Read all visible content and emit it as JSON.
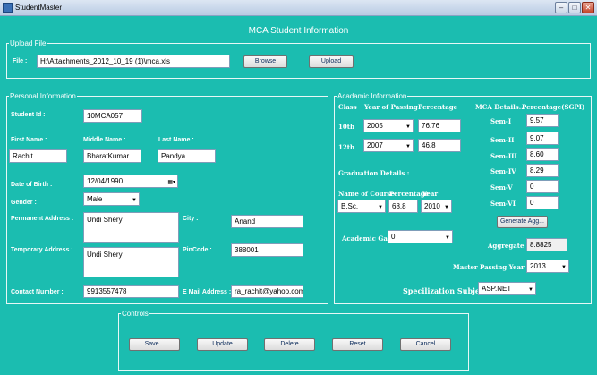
{
  "window": {
    "title": "StudentMaster",
    "min": "–",
    "max": "□",
    "close": "✕"
  },
  "form_title": "MCA Student Information",
  "upload": {
    "legend": "Upload File",
    "file_label": "File :",
    "file_value": "H:\\Attachments_2012_10_19 (1)\\mca.xls",
    "browse": "Browse",
    "upload": "Upload"
  },
  "personal": {
    "legend": "Personal Information",
    "student_id_label": "Student Id :",
    "student_id": "10MCA057",
    "first_name_label": "First Name :",
    "first_name": "Rachit",
    "middle_name_label": "Middle Name :",
    "middle_name": "BharatKumar",
    "last_name_label": "Last Name :",
    "last_name": "Pandya",
    "dob_label": "Date of Birth :",
    "dob": "12/04/1990",
    "gender_label": "Gender :",
    "gender": "Male",
    "perm_addr_label": "Permanent Address :",
    "perm_addr": "Undi Shery",
    "temp_addr_label": "Temporary Address :",
    "temp_addr": "Undi Shery",
    "city_label": "City :",
    "city": "Anand",
    "pincode_label": "PinCode :",
    "pincode": "388001",
    "contact_label": "Contact Number :",
    "contact": "9913557478",
    "email_label": "E Mail Address :",
    "email": "ra_rachit@yahoo.com"
  },
  "academic": {
    "legend": "Acadamic Information",
    "class_header": "Class",
    "year_header": "Year of Passing",
    "pct_header": "Percentage",
    "rows": [
      {
        "class": "10th",
        "year": "2005",
        "pct": "76.76"
      },
      {
        "class": "12th",
        "year": "2007",
        "pct": "46.8"
      }
    ],
    "grad_label": "Graduation Details :",
    "course_header": "Name of Course",
    "grad_pct_header": "Percentage",
    "grad_year_header": "Year",
    "course": "B.Sc.",
    "grad_pct": "68.8",
    "grad_year": "2010",
    "gap_label": "Academic Gap",
    "gap": "0",
    "mca_header": "MCA Details..",
    "sgpi_header": "Percentage(SGPI)",
    "semesters": [
      {
        "label": "Sem-I",
        "value": "9.57"
      },
      {
        "label": "Sem-II",
        "value": "9.07"
      },
      {
        "label": "Sem-III",
        "value": "8.60"
      },
      {
        "label": "Sem-IV",
        "value": "8.29"
      },
      {
        "label": "Sem-V",
        "value": "0"
      },
      {
        "label": "Sem-VI",
        "value": "0"
      }
    ],
    "generate_btn": "Generate Agg...",
    "aggregate_label": "Aggregate :",
    "aggregate": "8.8825",
    "master_year_label": "Master Passing Year :",
    "master_year": "2013",
    "spec_label": "Specilization Subject",
    "spec": "ASP.NET"
  },
  "controls": {
    "legend": "Controls",
    "save": "Save...",
    "update": "Update",
    "delete": "Delete",
    "reset": "Reset",
    "cancel": "Cancel"
  }
}
